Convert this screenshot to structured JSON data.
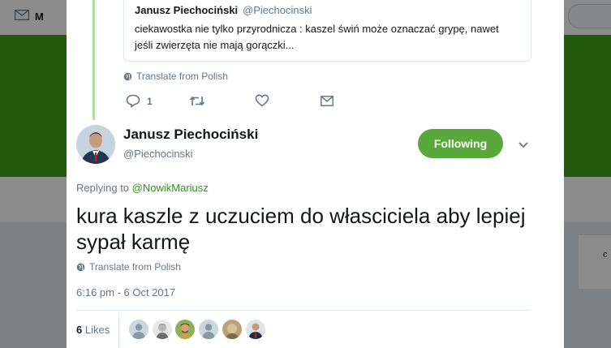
{
  "background": {
    "nav_letter": "M",
    "search_placeholder": "",
    "side_card_letter": "c"
  },
  "quoted_tweet": {
    "name": "Janusz Piechociński",
    "handle": "@Piechocinski",
    "text": "ciekawostka nie tylko przyrodnicza : kaszel świń może oznaczać grypę, nawet jeśli zwierzęta nie mają gorączki..."
  },
  "parent_tweet": {
    "translate_label": "Translate from Polish",
    "reply_count": "1"
  },
  "tweet": {
    "author_name": "Janusz Piechociński",
    "author_handle": "@Piechocinski",
    "follow_label": "Following",
    "replying_prefix": "Replying to",
    "replying_to": "@NowikMariusz",
    "text": "kura kaszle z uczuciem do własciciela aby lepiej sypał karmę",
    "translate_label": "Translate from Polish",
    "timestamp": "6:16 pm - 6 Oct 2017",
    "likes_count": "6",
    "likes_label": "Likes"
  },
  "colors": {
    "accent_green": "#59a83b",
    "link_green": "#2f9418",
    "header_green": "#41a319"
  },
  "icons": [
    "globe-icon",
    "reply-icon",
    "retweet-icon",
    "heart-icon",
    "mail-icon",
    "chevron-down-icon"
  ]
}
